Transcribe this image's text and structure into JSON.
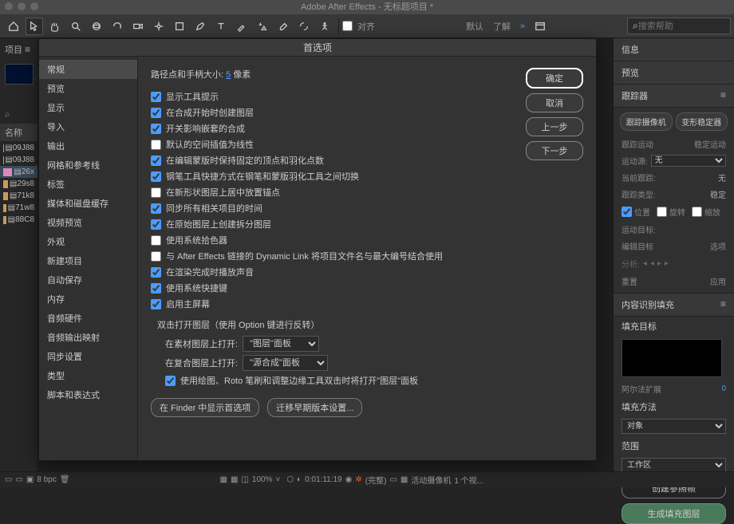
{
  "titlebar": "Adobe After Effects - 无标题项目 *",
  "topbar": {
    "snap_label": "对齐",
    "tabs": [
      "默认",
      "了解"
    ],
    "search_placeholder": "搜索帮助"
  },
  "left": {
    "project": "项目",
    "name_hdr": "名称",
    "items": [
      "09J88",
      "09J88",
      "26x",
      "29s8",
      "71k8",
      "71w8",
      "88C8"
    ]
  },
  "right": {
    "info": "信息",
    "preview": "预览",
    "tracker": "跟踪器",
    "track_cam": "跟踪摄像机",
    "warp_stab": "变形稳定器",
    "track_motion": "跟踪运动",
    "stab_motion": "稳定运动",
    "motion_src": "运动源:",
    "motion_src_val": "无",
    "cur_track": "当前跟踪:",
    "cur_track_val": "无",
    "track_type": "跟踪类型:",
    "track_type_val": "稳定",
    "ck_pos": "位置",
    "ck_rot": "旋转",
    "ck_scale": "缩放",
    "motion_target": "运动目标:",
    "edit_target": "编辑目标",
    "options": "选项",
    "analysis": "分析:",
    "reset": "重置",
    "apply": "应用",
    "caf_title": "内容识别填充",
    "fill_target": "填充目标",
    "alpha_exp": "阿尔法扩展",
    "alpha_val": "0",
    "fill_method": "填充方法",
    "fill_method_val": "对象",
    "range": "范围",
    "range_val": "工作区",
    "create_ref": "创建参照帧",
    "gen_fill": "生成填充图层"
  },
  "dialog": {
    "title": "首选项",
    "ok": "确定",
    "cancel": "取消",
    "prev": "上一步",
    "next": "下一步",
    "cats": [
      "常规",
      "预览",
      "显示",
      "导入",
      "输出",
      "网格和参考线",
      "标签",
      "媒体和磁盘缓存",
      "视频预览",
      "外观",
      "新建项目",
      "自动保存",
      "内存",
      "音频硬件",
      "音频输出映射",
      "同步设置",
      "类型",
      "脚本和表达式"
    ],
    "path_label": "路径点和手柄大小:",
    "path_val": "5",
    "path_unit": "像素",
    "opts": [
      {
        "k": "o1",
        "label": "显示工具提示",
        "c": true
      },
      {
        "k": "o2",
        "label": "在合成开始时创建图层",
        "c": true
      },
      {
        "k": "o3",
        "label": "开关影响嵌套的合成",
        "c": true
      },
      {
        "k": "o4",
        "label": "默认的空间插值为线性",
        "c": false
      },
      {
        "k": "o5",
        "label": "在编辑蒙版时保持固定的顶点和羽化点数",
        "c": true
      },
      {
        "k": "o6",
        "label": "钢笔工具快捷方式在钢笔和蒙版羽化工具之间切换",
        "c": true
      },
      {
        "k": "o7",
        "label": "在新形状图层上居中放置锚点",
        "c": false
      },
      {
        "k": "o8",
        "label": "同步所有相关项目的时间",
        "c": true
      },
      {
        "k": "o9",
        "label": "在原始图层上创建拆分图层",
        "c": true
      },
      {
        "k": "o10",
        "label": "使用系统拾色器",
        "c": false
      },
      {
        "k": "o11",
        "label": "与 After Effects 链接的 Dynamic Link 将项目文件名与最大编号结合使用",
        "c": false
      },
      {
        "k": "o12",
        "label": "在渲染完成时播放声音",
        "c": true
      },
      {
        "k": "o13",
        "label": "使用系统快捷键",
        "c": true
      },
      {
        "k": "o14",
        "label": "启用主屏幕",
        "c": true
      }
    ],
    "dblclick_hdr": "双击打开图层（使用 Option 键进行反转）",
    "footage_lbl": "在素材图层上打开:",
    "footage_val": "\"图层\"面板",
    "comp_lbl": "在复合图层上打开:",
    "comp_val": "\"源合成\"面板",
    "paint_lbl": "使用绘图、Roto 笔刷和调整边缘工具双击时将打开\"图层\"面板",
    "finder": "在 Finder 中显示首选项",
    "migrate": "迁移早期版本设置..."
  },
  "bottom": {
    "bpc": "8 bpc",
    "zoom": "100%",
    "timecode": "0:01:11:19",
    "res": "(完整)",
    "cam": "活动摄像机",
    "views": "1 个视..."
  }
}
